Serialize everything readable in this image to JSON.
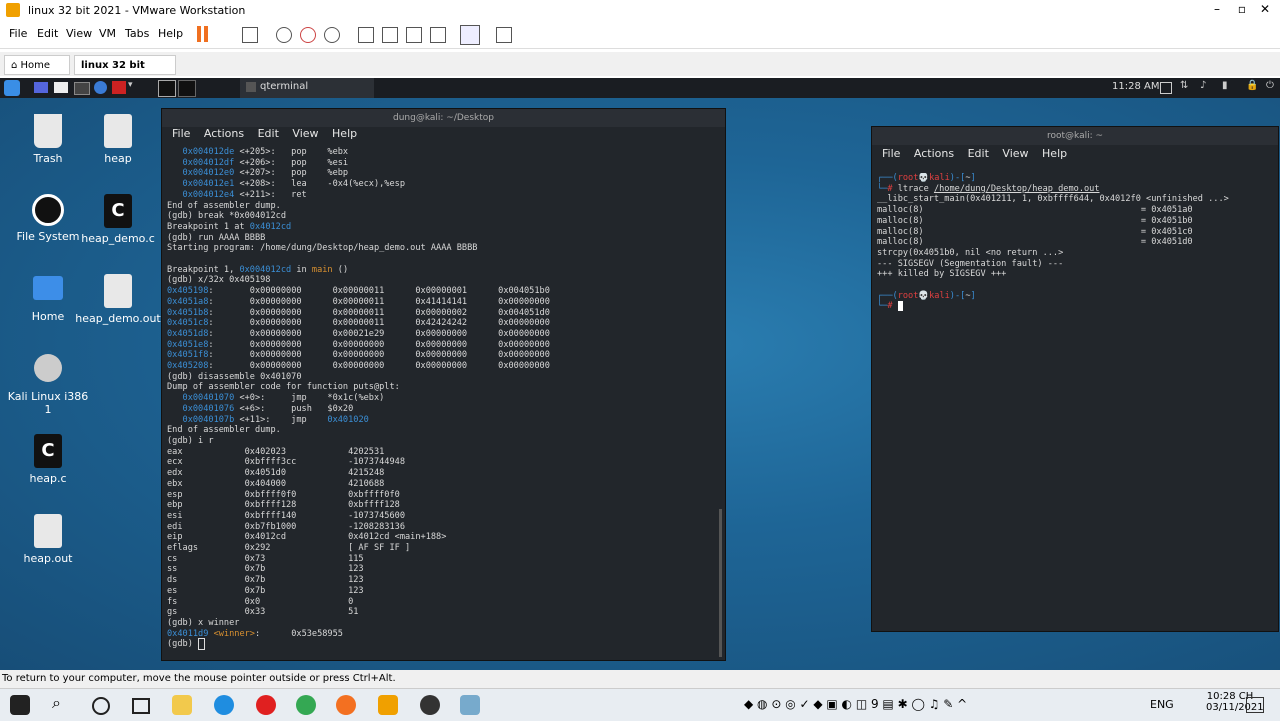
{
  "vm": {
    "window_title": "linux 32 bit 2021 - VMware Workstation",
    "menu": [
      "File",
      "Edit",
      "View",
      "VM",
      "Tabs",
      "Help"
    ],
    "tabs": [
      {
        "label": "Home"
      },
      {
        "label": "linux 32 bit 2021"
      }
    ],
    "status_text": "To return to your computer, move the mouse pointer outside or press Ctrl+Alt."
  },
  "kali": {
    "panel_task": "qterminal",
    "clock": "11:28 AM",
    "desktop_icons": [
      {
        "label": "Trash"
      },
      {
        "label": "heap"
      },
      {
        "label": "File System"
      },
      {
        "label": "heap_demo.c"
      },
      {
        "label": "Home"
      },
      {
        "label": "heap_demo.out"
      },
      {
        "label": "Kali Linux i386 1"
      },
      {
        "label": "heap.c"
      },
      {
        "label": "heap.out"
      }
    ]
  },
  "term_left": {
    "title": "dung@kali: ~/Desktop",
    "menu": [
      "File",
      "Actions",
      "Edit",
      "View",
      "Help"
    ]
  },
  "term_right": {
    "title": "root@kali: ~",
    "menu": [
      "File",
      "Actions",
      "Edit",
      "View",
      "Help"
    ]
  },
  "windows_taskbar": {
    "lang": "ENG",
    "time": "10:28 CH",
    "date": "03/11/2021"
  }
}
